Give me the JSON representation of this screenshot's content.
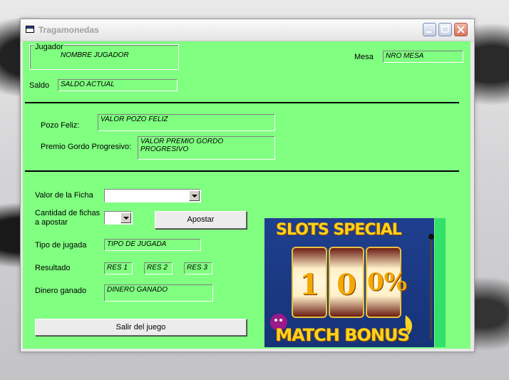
{
  "window": {
    "title": "Tragamonedas"
  },
  "jugador": {
    "legend": "Jugador",
    "value": "NOMBRE JUGADOR"
  },
  "mesa": {
    "label": "Mesa",
    "value": "NRO MESA"
  },
  "saldo": {
    "label": "Saldo",
    "value": "SALDO ACTUAL"
  },
  "pozo": {
    "label": "Pozo Feliz:",
    "value": "VALOR POZO FELIZ"
  },
  "premio": {
    "label": "Premio Gordo Progresivo:",
    "value": "VALOR PREMIO GORDO PROGRESIVO"
  },
  "ficha": {
    "label": "Valor de la Ficha",
    "value": ""
  },
  "cantidad": {
    "label_line1": "Cantidad de fichas",
    "label_line2": "a apostar",
    "value": ""
  },
  "apostar_button": "Apostar",
  "tipo": {
    "label": "Tipo de jugada",
    "value": "TIPO DE JUGADA"
  },
  "resultado": {
    "label": "Resultado",
    "values": [
      "RES 1",
      "RES 2",
      "RES 3"
    ]
  },
  "dinero": {
    "label": "Dinero ganado",
    "value": "DINERO GANADO"
  },
  "salir_button": "Salir del juego",
  "slot_image": {
    "top_text": "SLOTS SPECIAL",
    "reels": [
      "1",
      "0",
      "0%"
    ],
    "bottom_text": "MATCH BONUS"
  },
  "colors": {
    "form_background": "#80ff80",
    "slot_text": "#ffd21c"
  }
}
